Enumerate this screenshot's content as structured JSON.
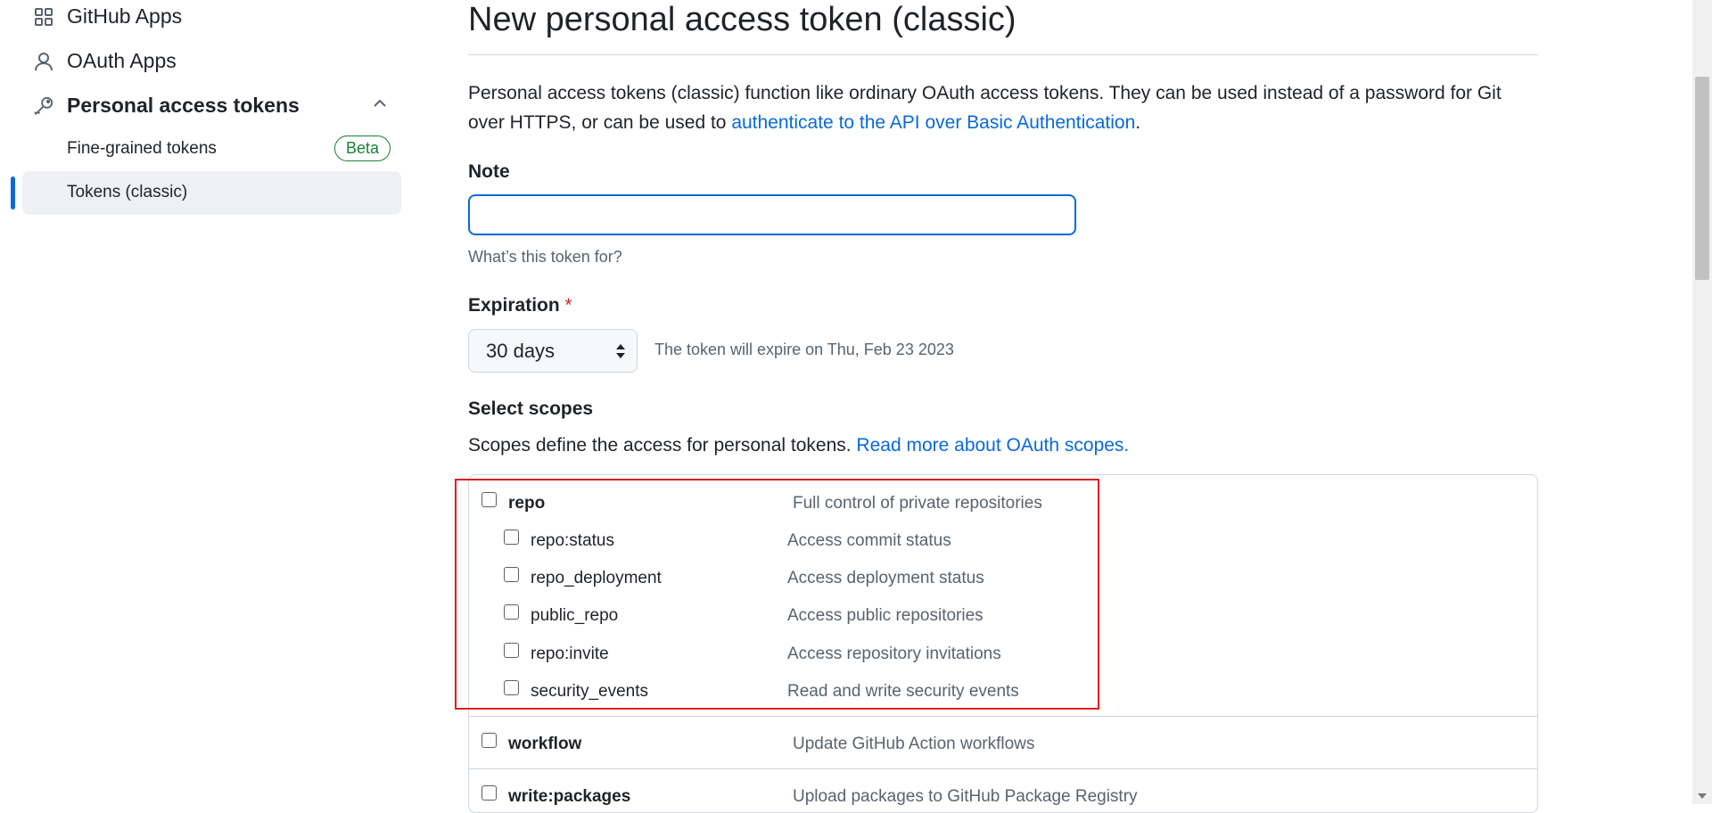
{
  "sidebar": {
    "github_apps": "GitHub Apps",
    "oauth_apps": "OAuth Apps",
    "personal_access_tokens": "Personal access tokens",
    "fine_grained_tokens": "Fine-grained tokens",
    "beta_badge": "Beta",
    "tokens_classic": "Tokens (classic)"
  },
  "page": {
    "title": "New personal access token (classic)",
    "intro_text": "Personal access tokens (classic) function like ordinary OAuth access tokens. They can be used instead of a password for Git over HTTPS, or can be used to ",
    "intro_link": "authenticate to the API over Basic Authentication",
    "intro_end": "."
  },
  "note": {
    "label": "Note",
    "value": "",
    "hint": "What’s this token for?"
  },
  "expiration": {
    "label": "Expiration",
    "required_mark": "*",
    "selected": "30 days",
    "expire_text": "The token will expire on Thu, Feb 23 2023"
  },
  "scopes": {
    "heading": "Select scopes",
    "description": "Scopes define the access for personal tokens. ",
    "read_more_link": "Read more about OAuth scopes.",
    "items": [
      {
        "name": "repo",
        "desc": "Full control of private repositories"
      },
      {
        "name": "repo:status",
        "desc": "Access commit status"
      },
      {
        "name": "repo_deployment",
        "desc": "Access deployment status"
      },
      {
        "name": "public_repo",
        "desc": "Access public repositories"
      },
      {
        "name": "repo:invite",
        "desc": "Access repository invitations"
      },
      {
        "name": "security_events",
        "desc": "Read and write security events"
      },
      {
        "name": "workflow",
        "desc": "Update GitHub Action workflows"
      },
      {
        "name": "write:packages",
        "desc": "Upload packages to GitHub Package Registry"
      }
    ]
  },
  "colors": {
    "accent": "#0969da",
    "highlight_box": "#e11d1d",
    "beta_green": "#1a7f37",
    "required_red": "#cf222e"
  },
  "icons": {
    "github_apps": "apps-grid-icon",
    "oauth_apps": "person-icon",
    "personal_access_tokens": "key-icon",
    "collapse": "chevron-up-icon",
    "select_arrows": "select-arrows-icon"
  }
}
